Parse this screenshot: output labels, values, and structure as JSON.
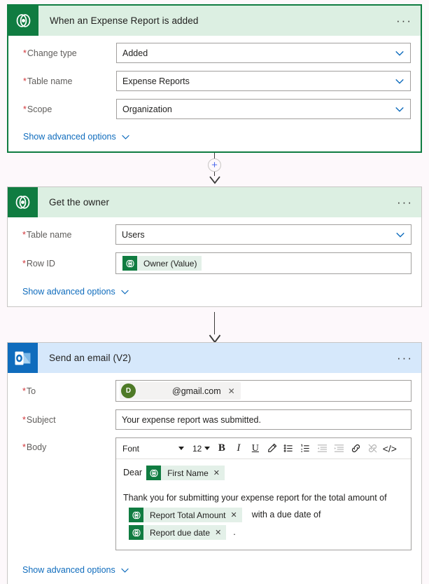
{
  "flow": {
    "trigger": {
      "icon": "dataverse-icon",
      "title": "When an Expense Report is added",
      "more_label": "···",
      "fields": [
        {
          "label": "Change type",
          "required": true,
          "value": "Added",
          "control": "dropdown"
        },
        {
          "label": "Table name",
          "required": true,
          "value": "Expense Reports",
          "control": "dropdown"
        },
        {
          "label": "Scope",
          "required": true,
          "value": "Organization",
          "control": "dropdown"
        }
      ],
      "show_advanced": "Show advanced options"
    },
    "connector_1": {
      "plus_label": "+",
      "icon": "plus-circle-icon"
    },
    "action_get_owner": {
      "icon": "dataverse-icon",
      "title": "Get the owner",
      "more_label": "···",
      "fields": [
        {
          "label": "Table name",
          "required": true,
          "value": "Users",
          "control": "dropdown"
        },
        {
          "label": "Row ID",
          "required": true,
          "control": "token",
          "token": {
            "label": "Owner (Value)",
            "icon": "dataverse-token-icon"
          }
        }
      ],
      "show_advanced": "Show advanced options"
    },
    "connector_2": {
      "icon": "arrow-down-icon"
    },
    "action_send_email": {
      "icon": "outlook-icon",
      "title": "Send an email (V2)",
      "more_label": "···",
      "to": {
        "label": "To",
        "required": true,
        "avatar_initial": "D",
        "recipient": "@gmail.com",
        "remove_label": "✕"
      },
      "subject": {
        "label": "Subject",
        "required": true,
        "value": "Your expense report was submitted."
      },
      "body": {
        "label": "Body",
        "required": true,
        "toolbar": {
          "font_value": "Font",
          "size_value": "12",
          "bold": "B",
          "italic": "I",
          "underline": "U",
          "highlight": "highlight-pen-icon",
          "bulleted_list": "bulleted-list-icon",
          "numbered_list": "numbered-list-icon",
          "outdent": "decrease-indent-icon",
          "indent": "increase-indent-icon",
          "link": "link-icon",
          "unlink": "unlink-icon",
          "code_view": "</>"
        },
        "content": {
          "greeting_text": "Dear",
          "greeting_token": {
            "label": "First Name",
            "remove": "✕"
          },
          "paragraph_text": "Thank you for submitting your expense report for the total amount of",
          "amount_token": {
            "label": "Report Total Amount",
            "remove": "✕"
          },
          "middle_text": "with a due date of",
          "date_token": {
            "label": "Report due date",
            "remove": "✕"
          },
          "trailing_text": "."
        }
      },
      "show_advanced": "Show advanced options"
    }
  },
  "colors": {
    "dataverse_green": "#107c41",
    "header_green": "#dcefe2",
    "outlook_blue": "#0f6cbd",
    "header_blue": "#d6e8fb",
    "token_bg": "#e3f0e8",
    "link_blue": "#0f6cbd",
    "required_red": "#d13438",
    "canvas_bg": "#fdf8fb",
    "avatar_green": "#4e7a27"
  }
}
